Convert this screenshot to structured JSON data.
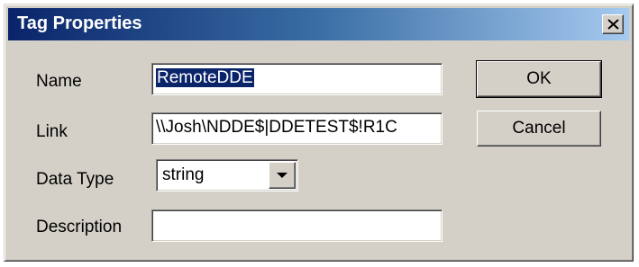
{
  "window": {
    "title": "Tag Properties",
    "close_icon": "close-icon"
  },
  "form": {
    "name_label": "Name",
    "name_value": "RemoteDDE",
    "link_label": "Link",
    "link_value": "\\\\Josh\\NDDE$|DDETEST$!R1C",
    "data_type_label": "Data Type",
    "data_type_value": "string",
    "description_label": "Description",
    "description_value": ""
  },
  "buttons": {
    "ok_label": "OK",
    "cancel_label": "Cancel"
  },
  "colors": {
    "titlebar_start": "#0a246a",
    "titlebar_end": "#a6caf0",
    "dialog_face": "#d4d0c8",
    "selection": "#0a246a"
  }
}
